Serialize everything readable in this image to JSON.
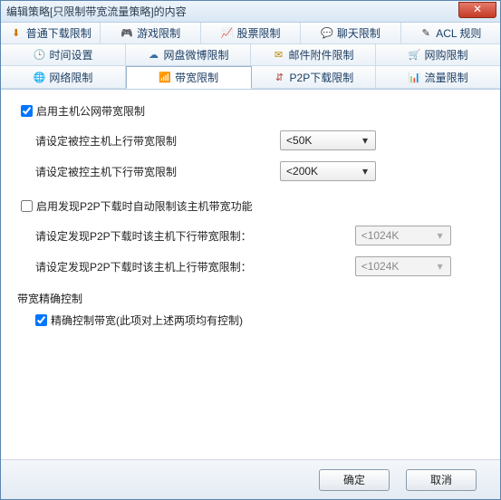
{
  "window": {
    "title": "编辑策略[只限制带宽流量策略]的内容"
  },
  "tabs": {
    "row0": [
      {
        "icon": "⬇",
        "color": "#d07800",
        "label": "普通下载限制"
      },
      {
        "icon": "🎮",
        "color": "#6a3b9e",
        "label": "游戏限制"
      },
      {
        "icon": "📈",
        "color": "#8b1c1c",
        "label": "股票限制"
      },
      {
        "icon": "💬",
        "color": "#2e8b2e",
        "label": "聊天限制"
      },
      {
        "icon": "✎",
        "color": "#333",
        "label": "ACL 规则"
      }
    ],
    "row1": [
      {
        "icon": "🕒",
        "color": "#c98b00",
        "label": "时间设置"
      },
      {
        "icon": "☁",
        "color": "#3d6fa3",
        "label": "网盘微博限制"
      },
      {
        "icon": "✉",
        "color": "#b98600",
        "label": "邮件附件限制"
      },
      {
        "icon": "🛒",
        "color": "#2a7a2a",
        "label": "网购限制"
      }
    ],
    "row2": [
      {
        "icon": "🌐",
        "color": "#2d6fb5",
        "label": "网络限制"
      },
      {
        "icon": "📶",
        "color": "#1e7a4a",
        "label": "带宽限制",
        "active": true
      },
      {
        "icon": "⇵",
        "color": "#b0443a",
        "label": "P2P下载限制"
      },
      {
        "icon": "📊",
        "color": "#c2466b",
        "label": "流量限制"
      }
    ]
  },
  "body": {
    "enable_public_bw": {
      "label": "启用主机公网带宽限制",
      "checked": true
    },
    "upload_label": "请设定被控主机上行带宽限制",
    "upload_value": "<50K",
    "download_label": "请设定被控主机下行带宽限制",
    "download_value": "<200K",
    "enable_p2p_auto": {
      "label": "启用发现P2P下载时自动限制该主机带宽功能",
      "checked": false
    },
    "p2p_down_label": "请设定发现P2P下载时该主机下行带宽限制：",
    "p2p_down_value": "<1024K",
    "p2p_up_label": "请设定发现P2P下载时该主机上行带宽限制：",
    "p2p_up_value": "<1024K",
    "precise_title": "带宽精确控制",
    "precise_ctrl": {
      "label": "精确控制带宽(此项对上述两项均有控制)",
      "checked": true
    }
  },
  "footer": {
    "ok": "确定",
    "cancel": "取消"
  }
}
